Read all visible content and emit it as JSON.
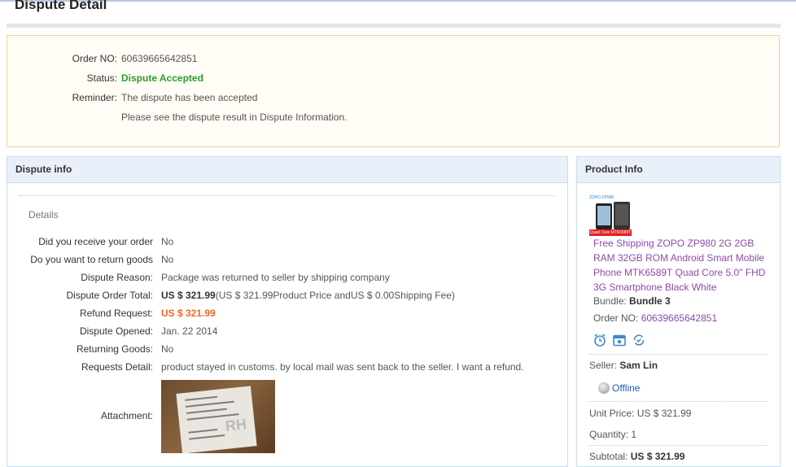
{
  "page": {
    "title": "Dispute Detail"
  },
  "summary": {
    "order_no_label": "Order NO:",
    "order_no": "60639665642851",
    "status_label": "Status:",
    "status": "Dispute Accepted",
    "reminder_label": "Reminder:",
    "reminder_line1": "The dispute has been accepted",
    "reminder_line2": "Please see the dispute result in Dispute Information."
  },
  "dispute_info": {
    "header": "Dispute info",
    "details_label": "Details",
    "rows": [
      {
        "label": "Did you receive your order",
        "value": "No"
      },
      {
        "label": "Do you want to return goods",
        "value": "No"
      },
      {
        "label": "Dispute Reason:",
        "value": "Package was returned to seller by shipping company"
      },
      {
        "label": "Dispute Order Total:",
        "value_bold": "US $ 321.99",
        "value_rest": "(US $ 321.99Product Price andUS $ 0.00Shipping Fee)"
      },
      {
        "label": "Refund Request:",
        "value": "US $ 321.99"
      },
      {
        "label": "Dispute Opened:",
        "value": "Jan. 22 2014"
      },
      {
        "label": "Returning Goods:",
        "value": "No"
      },
      {
        "label": "Requests Detail:",
        "value": "product stayed in customs. by local mail was sent back to the seller. I want a refund."
      },
      {
        "label": "Attachment:"
      }
    ],
    "colors": {
      "price": "#f26522",
      "accepted": "#2a9d2a"
    }
  },
  "product_info": {
    "header": "Product Info",
    "thumb_ribbon": "Quad Core MTK6589T",
    "thumb_corner": "ZOPO ZP980",
    "title": "Free Shipping ZOPO ZP980 2G 2GB RAM 32GB ROM Android Smart Mobile Phone MTK6589T Quad Core 5.0\" FHD 3G Smartphone Black White",
    "bundle_label": "Bundle:",
    "bundle": "Bundle 3",
    "order_no_label": "Order NO:",
    "order_no": "60639665642851",
    "icons": [
      "alarm-clock-icon",
      "calendar-icon",
      "refresh-check-icon"
    ],
    "seller_label": "Seller:",
    "seller": "Sam Lin",
    "offline": "Offline",
    "unit_price_label": "Unit Price:",
    "unit_price": "US $ 321.99",
    "quantity_label": "Quantity:",
    "quantity": "1",
    "subtotal_label": "Subtotal:",
    "subtotal": "US $ 321.99"
  }
}
